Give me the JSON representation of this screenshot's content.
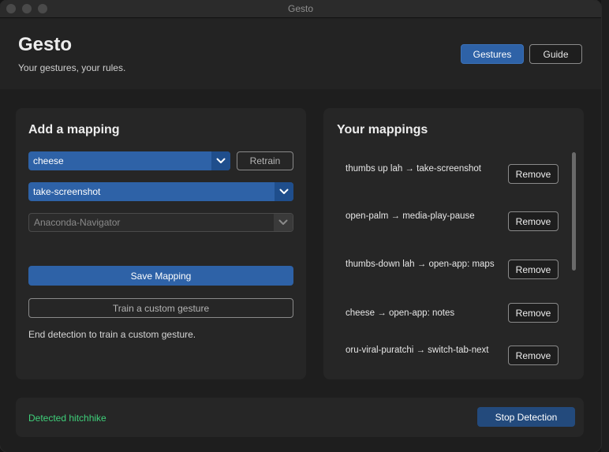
{
  "window": {
    "title": "Gesto"
  },
  "header": {
    "title": "Gesto",
    "subtitle": "Your gestures, your rules.",
    "nav": {
      "gestures_label": "Gestures",
      "guide_label": "Guide"
    }
  },
  "add_mapping": {
    "heading": "Add a mapping",
    "gesture_select": {
      "value": "cheese"
    },
    "retrain_label": "Retrain",
    "action_select": {
      "value": "take-screenshot"
    },
    "app_select": {
      "value": "Anaconda-Navigator"
    },
    "save_label": "Save Mapping",
    "train_label": "Train a custom gesture",
    "hint": "End detection to train a custom gesture."
  },
  "mappings": {
    "heading": "Your mappings",
    "remove_label": "Remove",
    "items": [
      {
        "text": "thumbs up lah → take-screenshot"
      },
      {
        "text": "open-palm → media-play-pause"
      },
      {
        "text": "thumbs-down lah → open-app: maps"
      },
      {
        "text": "cheese → open-app: notes"
      },
      {
        "text": "oru-viral-puratchi → switch-tab-next"
      }
    ]
  },
  "footer": {
    "status": "Detected hitchhike",
    "stop_label": "Stop Detection"
  },
  "colors": {
    "accent": "#2e62a7",
    "status_green": "#3fd07a",
    "stop_button": "#234a7c"
  }
}
